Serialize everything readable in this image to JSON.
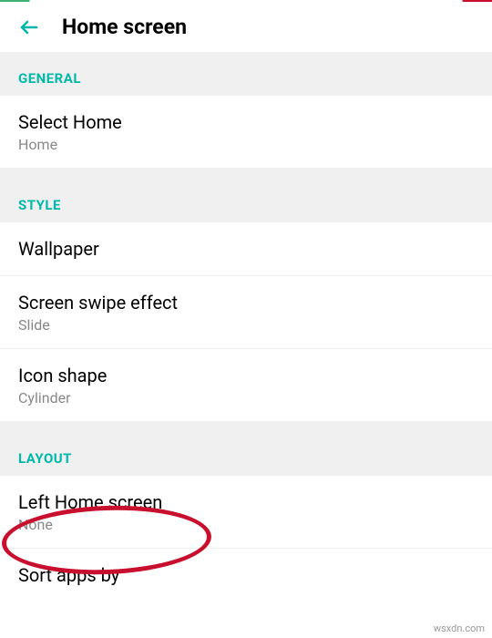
{
  "header": {
    "title": "Home screen"
  },
  "sections": {
    "general": {
      "label": "GENERAL",
      "select_home": {
        "title": "Select Home",
        "value": "Home"
      }
    },
    "style": {
      "label": "STYLE",
      "wallpaper": {
        "title": "Wallpaper"
      },
      "swipe_effect": {
        "title": "Screen swipe effect",
        "value": "Slide"
      },
      "icon_shape": {
        "title": "Icon shape",
        "value": "Cylinder"
      }
    },
    "layout": {
      "label": "LAYOUT",
      "left_home": {
        "title": "Left Home screen",
        "value": "None"
      },
      "sort_apps": {
        "title": "Sort apps by"
      }
    }
  },
  "watermark": "wsxdn.com",
  "colors": {
    "accent": "#00b8a9",
    "highlight": "#c8102e"
  }
}
